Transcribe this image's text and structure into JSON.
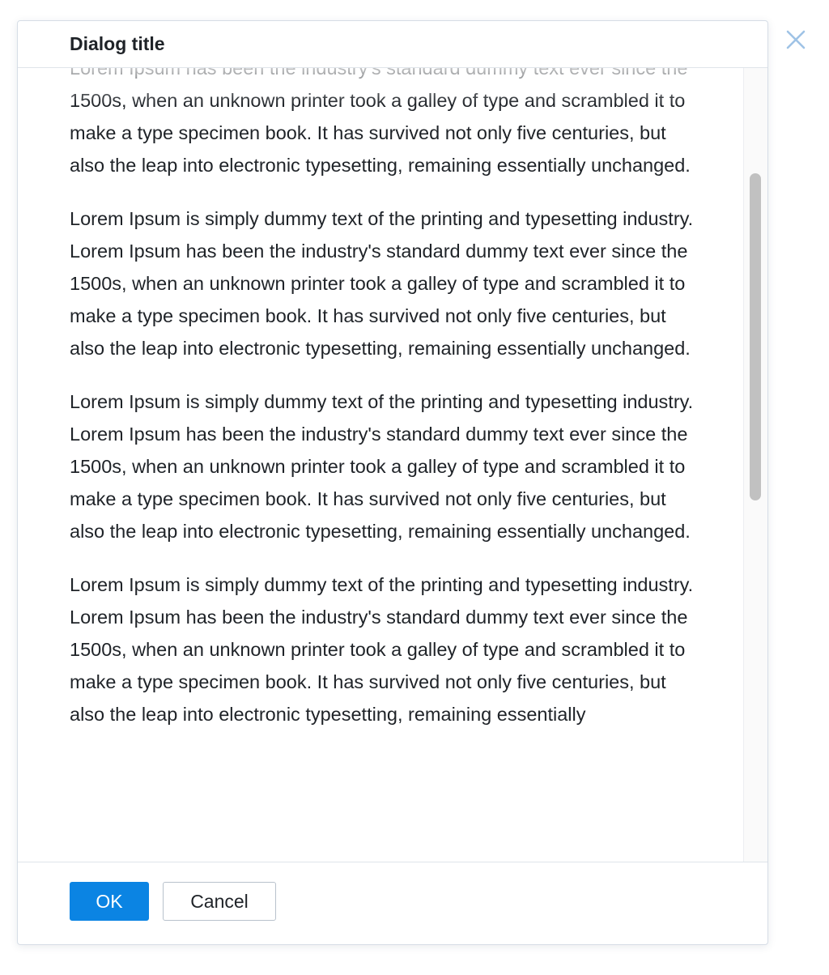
{
  "dialog": {
    "title": "Dialog title",
    "close_icon": "close-icon",
    "body": {
      "paragraphs": [
        "Lorem Ipsum is simply dummy text of the printing and typesetting industry. Lorem Ipsum has been the industry's standard dummy text ever since the 1500s, when an unknown printer took a galley of type and scrambled it to make a type specimen book. It has survived not only five centuries, but also the leap into electronic typesetting, remaining essentially unchanged.",
        "Lorem Ipsum is simply dummy text of the printing and typesetting industry. Lorem Ipsum has been the industry's standard dummy text ever since the 1500s, when an unknown printer took a galley of type and scrambled it to make a type specimen book. It has survived not only five centuries, but also the leap into electronic typesetting, remaining essentially unchanged.",
        "Lorem Ipsum is simply dummy text of the printing and typesetting industry. Lorem Ipsum has been the industry's standard dummy text ever since the 1500s, when an unknown printer took a galley of type and scrambled it to make a type specimen book. It has survived not only five centuries, but also the leap into electronic typesetting, remaining essentially unchanged.",
        "Lorem Ipsum is simply dummy text of the printing and typesetting industry. Lorem Ipsum has been the industry's standard dummy text ever since the 1500s, when an unknown printer took a galley of type and scrambled it to make a type specimen book. It has survived not only five centuries, but also the leap into electronic typesetting, remaining essentially"
      ]
    },
    "footer": {
      "ok_label": "OK",
      "cancel_label": "Cancel"
    }
  },
  "colors": {
    "primary": "#0b84e3",
    "close_icon": "#9fc3e6",
    "text": "#1f2328",
    "border": "#dfe4ea",
    "scrollbar_thumb": "#c1c1c1"
  }
}
